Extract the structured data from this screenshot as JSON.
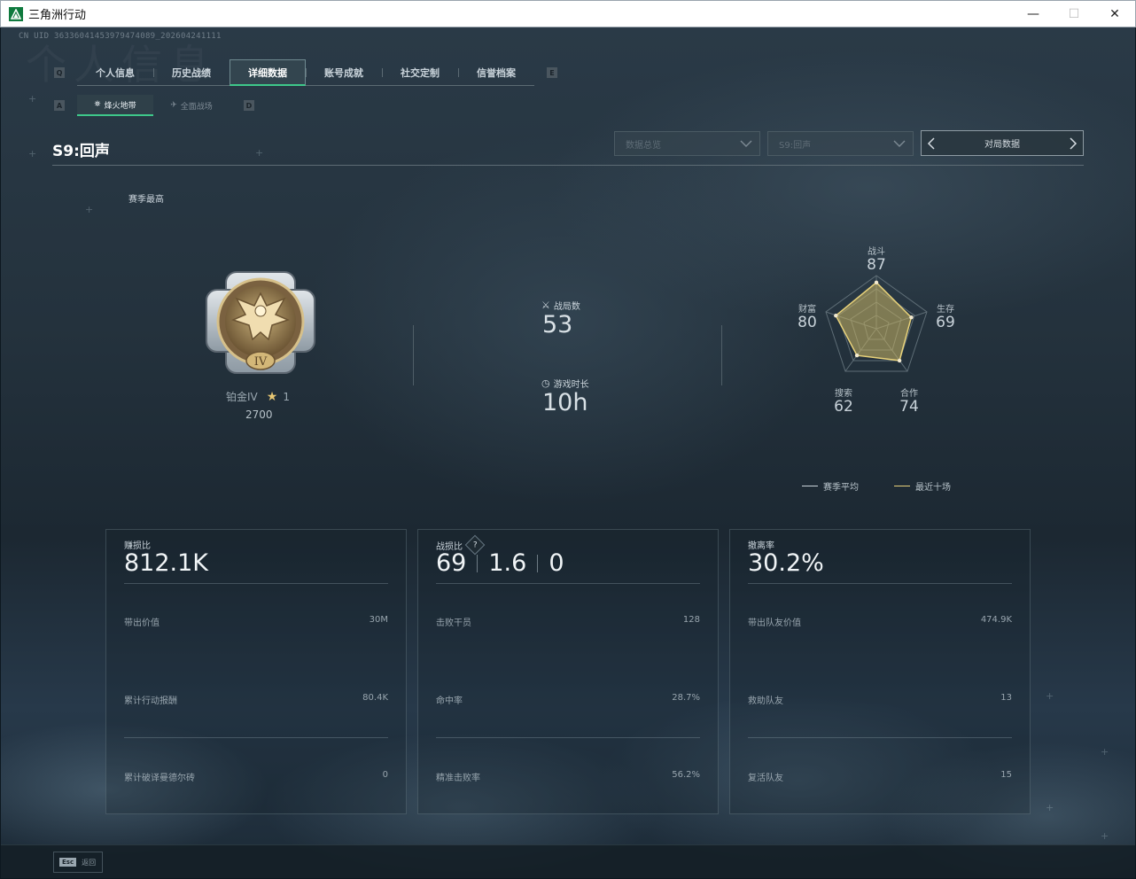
{
  "window": {
    "title": "三角洲行动",
    "minimize": "—",
    "maximize": "☐",
    "close": "✕"
  },
  "uid": "CN UID 363360414539794740​89_202604241111",
  "watermark": "个人信息",
  "main_tabs": {
    "left_key": "Q",
    "right_key": "E",
    "items": [
      "个人信息",
      "历史战绩",
      "详细数据",
      "账号成就",
      "社交定制",
      "信誉档案"
    ],
    "active_index": 2
  },
  "sub_tabs": {
    "left_key": "A",
    "right_key": "D",
    "items": [
      {
        "label": "烽火地带",
        "icon": "radar-dish-icon"
      },
      {
        "label": "全面战场",
        "icon": "aircraft-icon"
      }
    ],
    "active_index": 0
  },
  "season": {
    "title": "S9:回声",
    "select_1": "数据总览",
    "select_2": "S9:回声",
    "match_data": "对局数据"
  },
  "rank": {
    "season_best_label": "赛季最高",
    "name": "铂金IV",
    "stars": "1",
    "points": "2700",
    "badge_numeral": "IV"
  },
  "summary": {
    "matches_label": "战局数",
    "matches_value": "53",
    "playtime_label": "游戏时长",
    "playtime_value": "10h"
  },
  "radar": {
    "axes": [
      {
        "label": "战斗",
        "value": "87"
      },
      {
        "label": "生存",
        "value": "69"
      },
      {
        "label": "合作",
        "value": "74"
      },
      {
        "label": "搜索",
        "value": "62"
      },
      {
        "label": "财富",
        "value": "80"
      }
    ],
    "legend": [
      {
        "label": "赛季平均",
        "color": "#c9d3da"
      },
      {
        "label": "最近十场",
        "color": "#e8d27a"
      }
    ]
  },
  "cards": [
    {
      "title": "赚损比",
      "big": [
        "812.1K"
      ],
      "rows": [
        {
          "label": "带出价值",
          "value": "30M"
        },
        {
          "label": "累计行动报酬",
          "value": "80.4K"
        },
        {
          "label": "累计破译曼德尔砖",
          "value": "0"
        }
      ]
    },
    {
      "title": "战损比",
      "help": "?",
      "big": [
        "69",
        "1.6",
        "0"
      ],
      "rows": [
        {
          "label": "击败干员",
          "value": "128"
        },
        {
          "label": "命中率",
          "value": "28.7%"
        },
        {
          "label": "精准击败率",
          "value": "56.2%"
        }
      ]
    },
    {
      "title": "撤离率",
      "big": [
        "30.2%"
      ],
      "rows": [
        {
          "label": "带出队友价值",
          "value": "474.9K"
        },
        {
          "label": "救助队友",
          "value": "13"
        },
        {
          "label": "复活队友",
          "value": "15"
        }
      ]
    }
  ],
  "bottom": {
    "esc_key": "Esc",
    "esc_label": "返回"
  },
  "colors": {
    "accent_green": "#3ec88a",
    "radar_recent": "#e8d27a",
    "radar_fill": "#8a8453"
  }
}
